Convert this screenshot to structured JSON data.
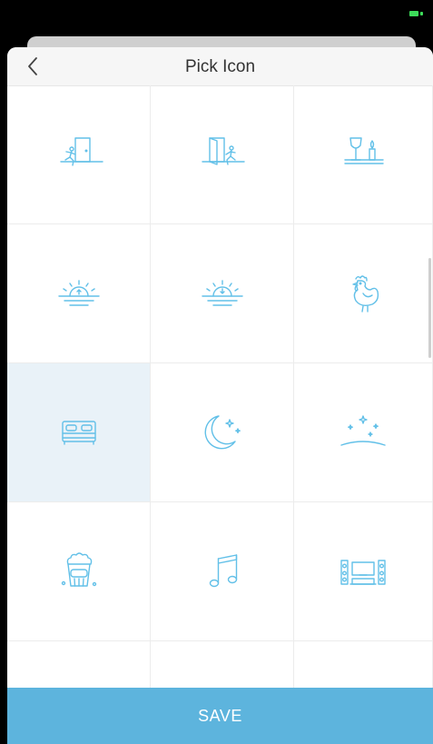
{
  "status_bar": {
    "battery_color": "#3ddc5a"
  },
  "header": {
    "title": "Pick Icon",
    "back_icon": "chevron-left-icon"
  },
  "icons": [
    {
      "name": "leave-home-icon",
      "selected": false
    },
    {
      "name": "arrive-home-icon",
      "selected": false
    },
    {
      "name": "dinner-candle-icon",
      "selected": false
    },
    {
      "name": "sunrise-icon",
      "selected": false
    },
    {
      "name": "sunset-icon",
      "selected": false
    },
    {
      "name": "rooster-icon",
      "selected": false
    },
    {
      "name": "bed-icon",
      "selected": true
    },
    {
      "name": "moon-stars-icon",
      "selected": false
    },
    {
      "name": "night-sky-icon",
      "selected": false
    },
    {
      "name": "popcorn-icon",
      "selected": false
    },
    {
      "name": "music-note-icon",
      "selected": false
    },
    {
      "name": "home-theater-icon",
      "selected": false
    }
  ],
  "footer": {
    "save_label": "SAVE"
  },
  "colors": {
    "accent": "#5db4dd",
    "icon_stroke": "#62c0e8",
    "selected_bg": "#e9f2f8"
  }
}
